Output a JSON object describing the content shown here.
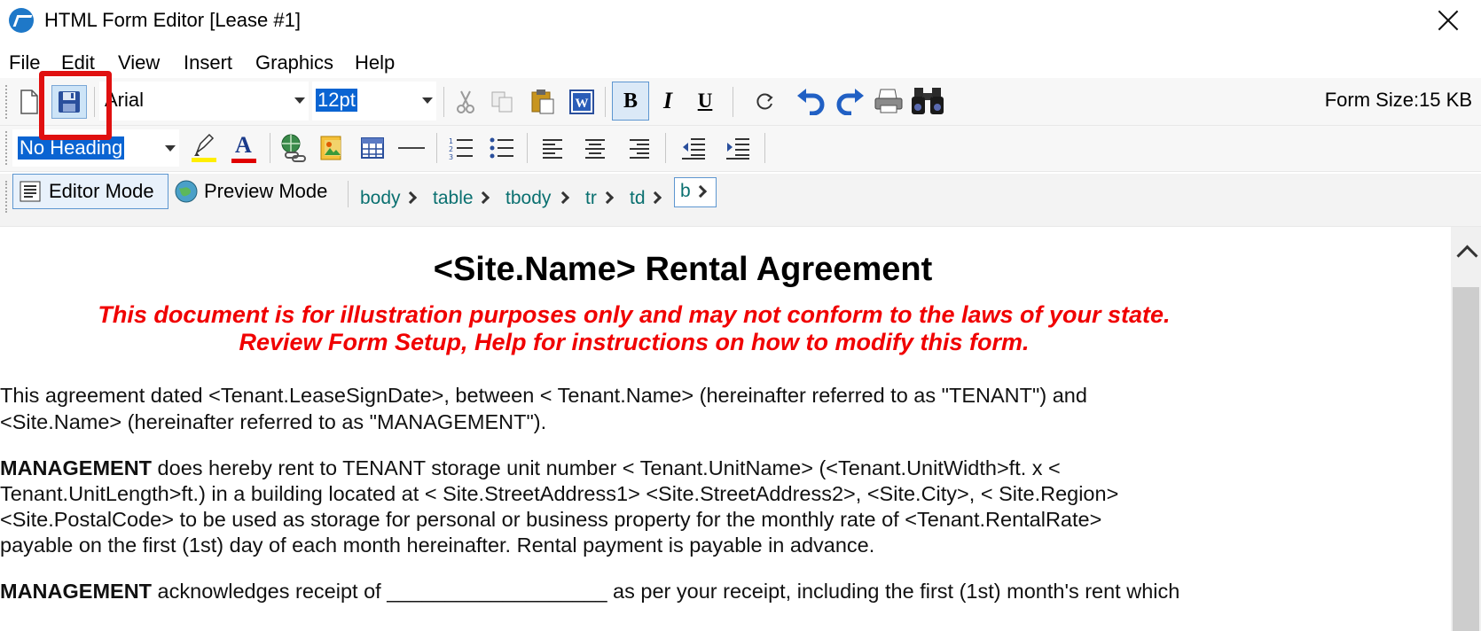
{
  "window": {
    "title": "HTML Form Editor [Lease #1]"
  },
  "menu": {
    "items": [
      "File",
      "Edit",
      "View",
      "Insert",
      "Graphics",
      "Help"
    ]
  },
  "toolbar1": {
    "font_name": "Arial",
    "font_size": "12pt",
    "form_size": "Form Size:15 KB",
    "bold_label": "B",
    "italic_label": "I",
    "underline_label": "U"
  },
  "toolbar2": {
    "heading": "No Heading",
    "font_color_label": "A"
  },
  "toolbar3": {
    "editor_mode": "Editor Mode",
    "preview_mode": "Preview Mode",
    "breadcrumb": [
      "body",
      "table",
      "tbody",
      "tr",
      "td",
      "b"
    ]
  },
  "document": {
    "title": "<Site.Name> Rental Agreement",
    "warning_line1": "This document is for illustration purposes only and may not conform to the laws of your state.",
    "warning_line2": "Review Form Setup, Help for instructions on how to modify this form.",
    "para1_line1": "This agreement dated <Tenant.LeaseSignDate>, between < Tenant.Name> (hereinafter referred to as \"TENANT\") and",
    "para1_line2": "<Site.Name> (hereinafter referred to as \"MANAGEMENT\").",
    "para2_bold": "MANAGEMENT",
    "para2_line1_rest": " does hereby rent to TENANT storage unit number < Tenant.UnitName> (<Tenant.UnitWidth>ft. x <",
    "para2_line2": "Tenant.UnitLength>ft.) in a building located at < Site.StreetAddress1> <Site.StreetAddress2>, <Site.City>, < Site.Region>",
    "para2_line3": "<Site.PostalCode> to be used as storage for personal or business property for the monthly rate of <Tenant.RentalRate>",
    "para2_line4": "payable on the first (1st) day of each month hereinafter. Rental payment is payable in advance.",
    "para3_bold": "MANAGEMENT",
    "para3_rest": " acknowledges receipt of ___________________ as per your receipt, including the first (1st) month's rent which"
  },
  "colors": {
    "highlight": "#e01010",
    "warning_text": "#f00000",
    "selection": "#0a64d2",
    "breadcrumb_link": "#0a7070"
  }
}
